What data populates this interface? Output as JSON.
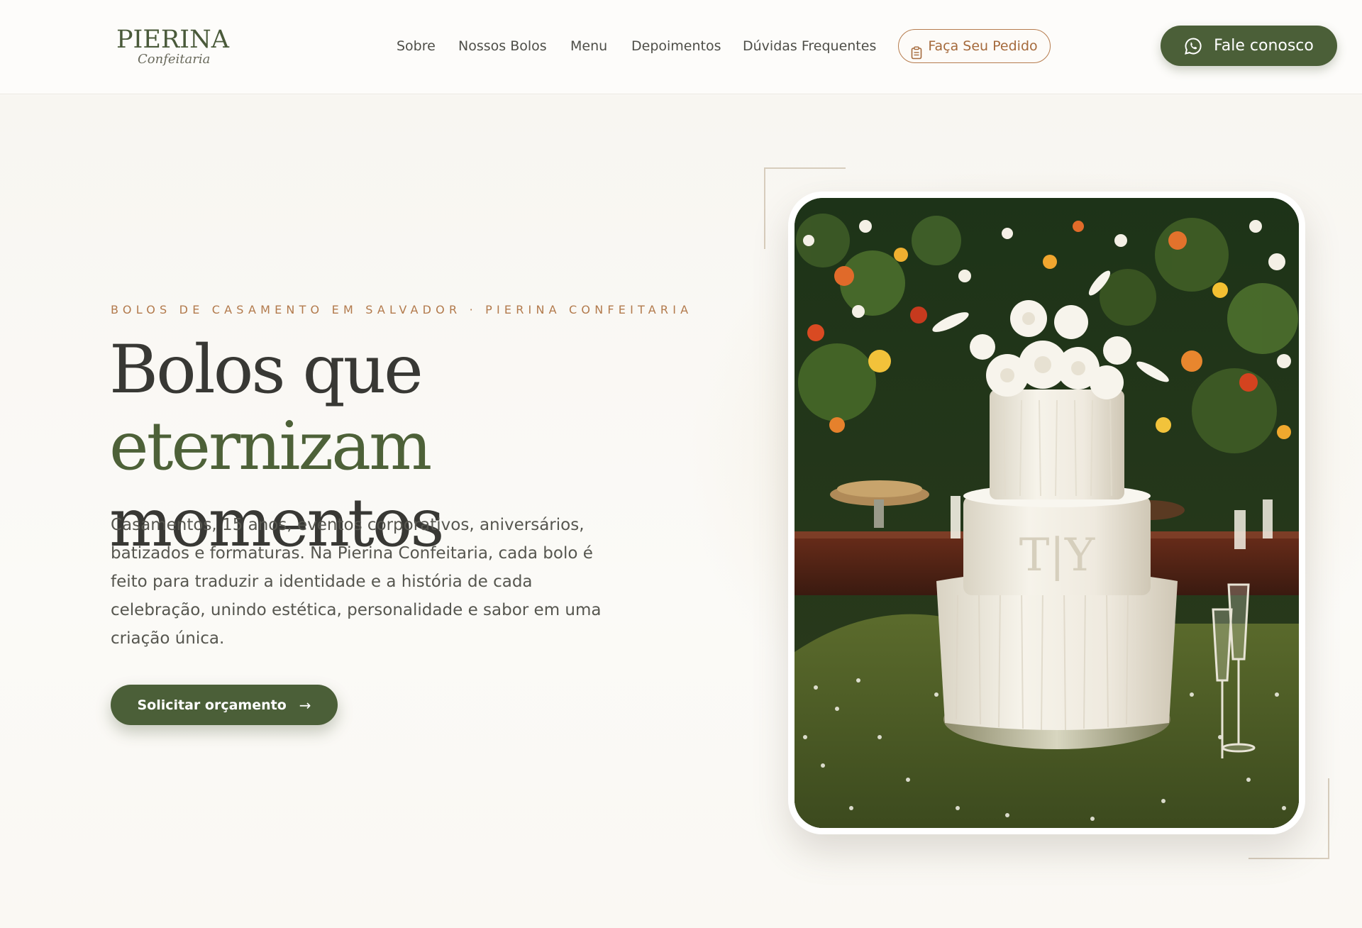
{
  "brand": {
    "name": "PIERINA",
    "tagline": "Confeitaria"
  },
  "nav": {
    "items": [
      "Sobre",
      "Nossos Bolos",
      "Menu",
      "Depoimentos",
      "Dúvidas Frequentes"
    ],
    "order_label": "Faça Seu Pedido",
    "contact_label": "Fale conosco"
  },
  "hero": {
    "eyebrow": "BOLOS DE CASAMENTO EM SALVADOR · PIERINA CONFEITARIA",
    "headline_part1": "Bolos que ",
    "headline_accent": "eternizam",
    "headline_part2": "momentos",
    "lead": "Casamentos, 15 anos, eventos corporativos, aniversários, batizados e formaturas. Na Pierina Confeitaria, cada bolo é feito para traduzir a identidade e a história de cada celebração, unindo estética, personalidade e sabor em uma criação única.",
    "cta_label": "Solicitar orçamento",
    "cake_monogram": "T|Y"
  },
  "colors": {
    "brand_green": "#4b5f38",
    "accent_copper": "#b27a4c",
    "text_dark": "#383834"
  },
  "icons": {
    "order": "clipboard-icon",
    "contact": "whatsapp-icon",
    "cta": "arrow-right-icon"
  }
}
